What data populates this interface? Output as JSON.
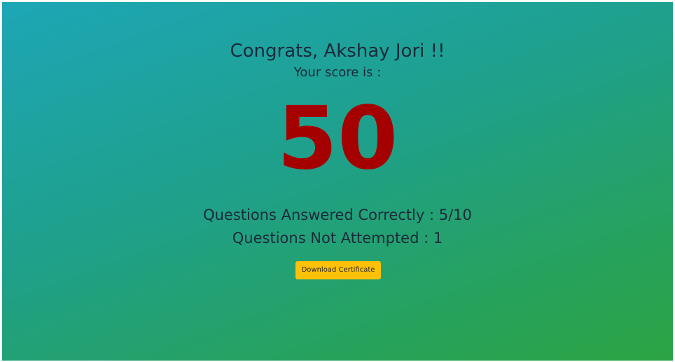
{
  "result": {
    "greeting": "Congrats, Akshay Jori !!",
    "score_label": "Your score is :",
    "score": "50",
    "correct_text": "Questions Answered Correctly : 5/10",
    "not_attempted_text": "Questions Not Attempted : 1"
  },
  "actions": {
    "download_label": "Download Certificate"
  },
  "colors": {
    "score": "#a50000",
    "button": "#ffc107",
    "gradient_start": "#1da6b6",
    "gradient_end": "#2ca444"
  }
}
